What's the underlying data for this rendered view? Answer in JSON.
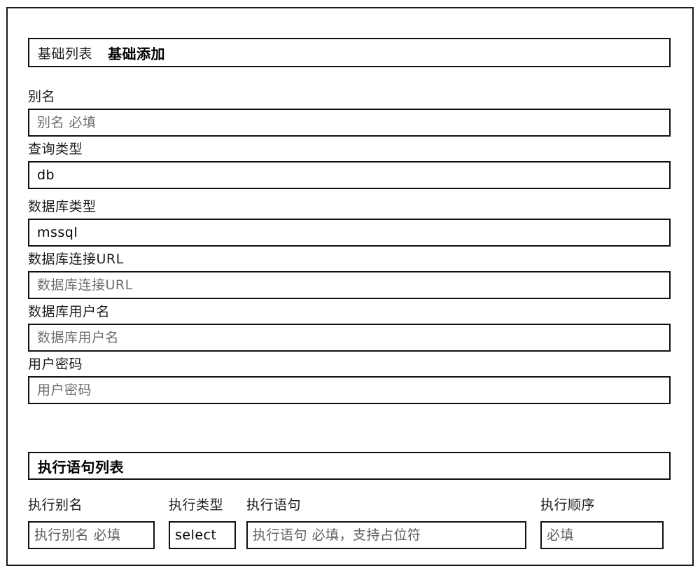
{
  "header": {
    "tab_list_label": "基础列表",
    "tab_add_label": "基础添加"
  },
  "form": {
    "fields": [
      {
        "label": "别名",
        "control": "input",
        "placeholder": "别名 必填",
        "value": "",
        "display": "别名 必填",
        "display_kind": "placeholder"
      },
      {
        "label": "查询类型",
        "control": "select",
        "placeholder": "",
        "value": "db",
        "display": "db",
        "display_kind": "value"
      },
      {
        "label": "数据库类型",
        "control": "select",
        "placeholder": "",
        "value": "mssql",
        "display": "mssql",
        "display_kind": "value"
      },
      {
        "label": "数据库连接URL",
        "control": "input",
        "placeholder": "数据库连接URL",
        "value": "",
        "display": "数据库连接URL",
        "display_kind": "placeholder"
      },
      {
        "label": "数据库用户名",
        "control": "input",
        "placeholder": "数据库用户名",
        "value": "",
        "display": "数据库用户名",
        "display_kind": "placeholder"
      },
      {
        "label": "用户密码",
        "control": "input",
        "placeholder": "用户密码",
        "value": "",
        "display": "用户密码",
        "display_kind": "placeholder"
      }
    ]
  },
  "statement_section": {
    "title": "执行语句列表",
    "columns": [
      "执行别名",
      "执行类型",
      "执行语句",
      "执行顺序"
    ],
    "row": {
      "alias": {
        "placeholder": "执行别名 必填",
        "value": "",
        "display": "执行别名 必填",
        "display_kind": "placeholder"
      },
      "type": {
        "placeholder": "",
        "value": "select",
        "display": "select",
        "display_kind": "value"
      },
      "statement": {
        "placeholder": "执行语句 必填，支持占位符",
        "value": "",
        "display": "执行语句 必填，支持占位符",
        "display_kind": "placeholder"
      },
      "order": {
        "placeholder": "必填",
        "value": "",
        "display": "必填",
        "display_kind": "placeholder"
      }
    }
  },
  "colors": {
    "border": "#111111",
    "text": "#000000",
    "placeholder": "#6e6e6e",
    "background": "#ffffff"
  }
}
